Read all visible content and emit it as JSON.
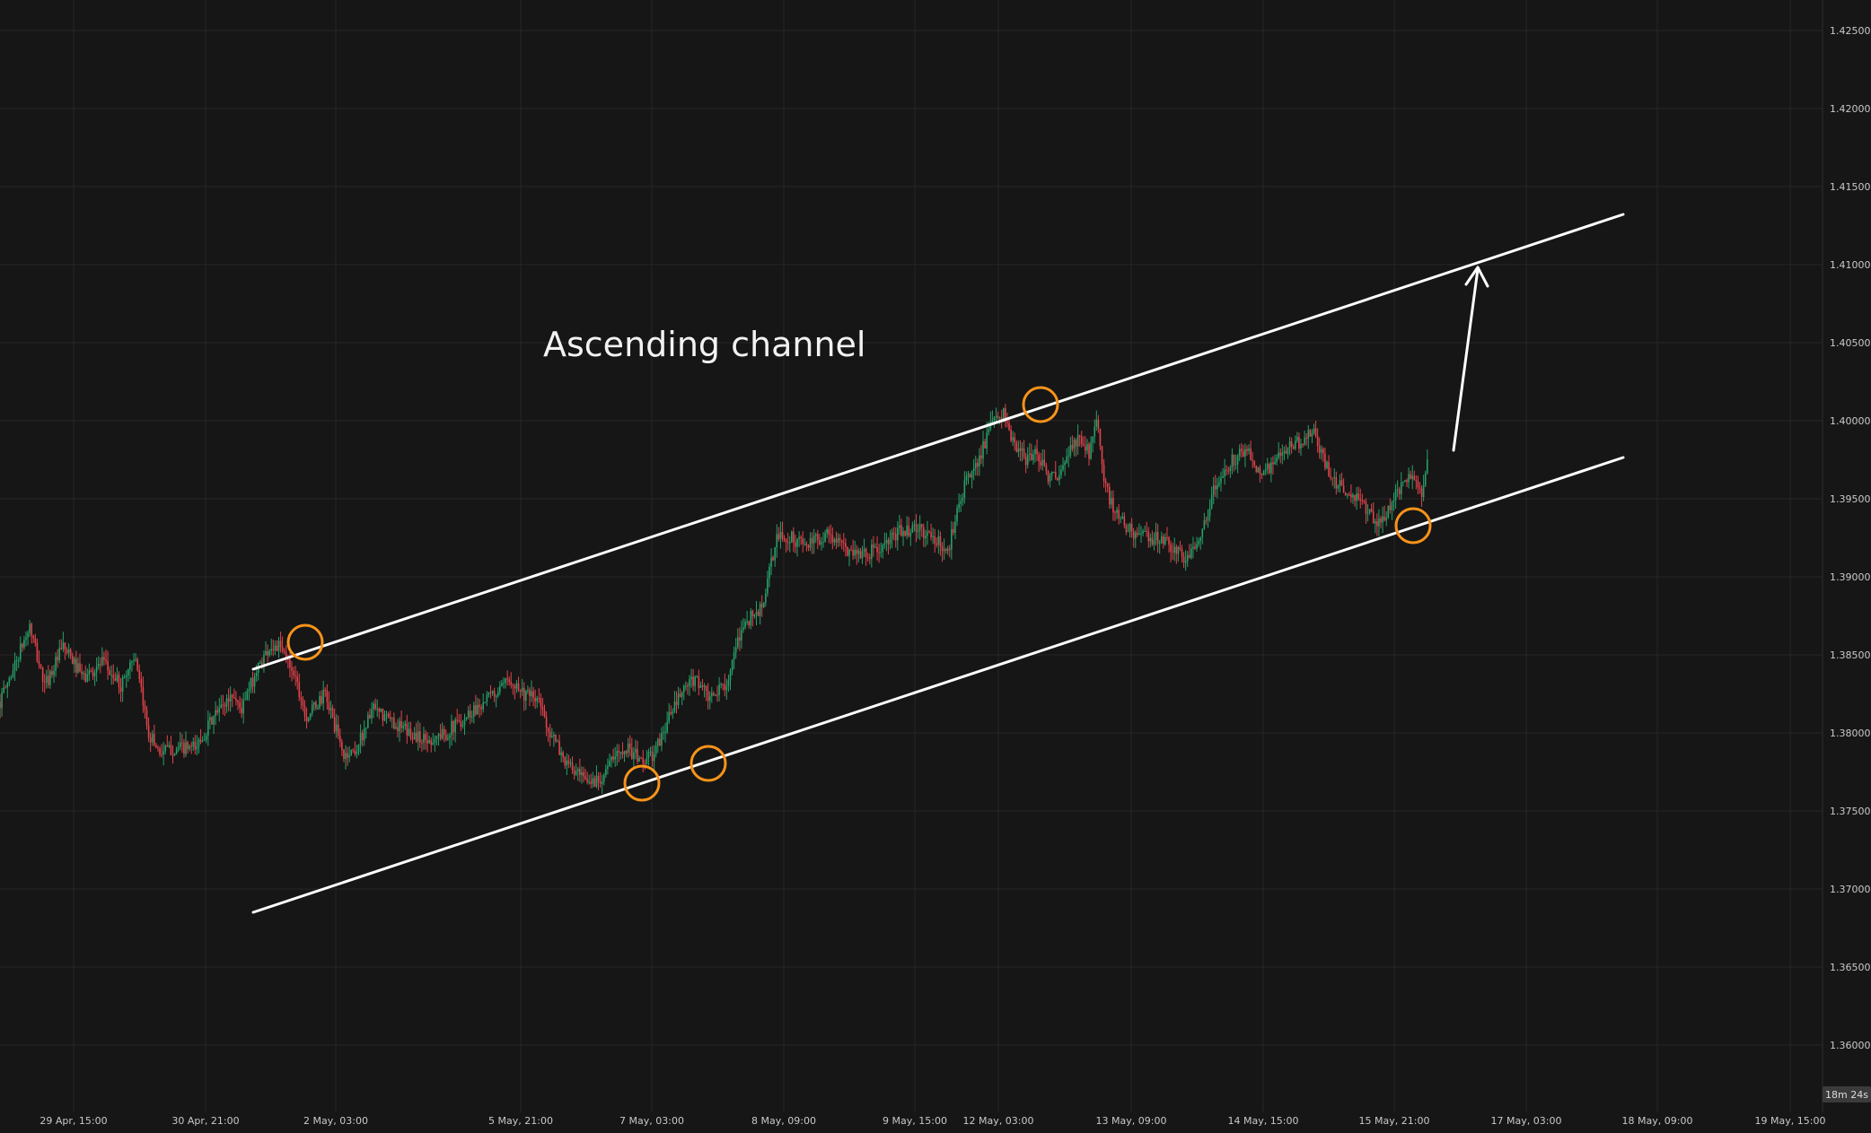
{
  "chart_data": {
    "type": "candlestick",
    "annotation": "Ascending channel",
    "ylim": [
      1.355,
      1.427
    ],
    "y_ticks": [
      "1.42500",
      "1.42000",
      "1.41500",
      "1.41000",
      "1.40500",
      "1.40000",
      "1.39500",
      "1.39000",
      "1.38500",
      "1.38000",
      "1.37500",
      "1.37000",
      "1.36500",
      "1.36000"
    ],
    "x_ticks": [
      "29 Apr, 15:00",
      "30 Apr, 21:00",
      "2 May, 03:00",
      "5 May, 21:00",
      "7 May, 03:00",
      "8 May, 09:00",
      "9 May, 15:00",
      "12 May, 03:00",
      "13 May, 09:00",
      "14 May, 15:00",
      "15 May, 21:00",
      "17 May, 03:00",
      "18 May, 09:00",
      "19 May, 15:00"
    ],
    "countdown": "18m 24s",
    "colors": {
      "background": "#161616",
      "grid": "#262626",
      "up": "#26a069",
      "down": "#e2434b",
      "channel": "#ffffff",
      "marker": "#f7931a",
      "arrow": "#ffffff"
    },
    "price_path": [
      [
        0,
        1.382
      ],
      [
        10,
        1.385
      ],
      [
        16,
        1.3868
      ],
      [
        24,
        1.383
      ],
      [
        34,
        1.3855
      ],
      [
        45,
        1.3835
      ],
      [
        55,
        1.3845
      ],
      [
        65,
        1.383
      ],
      [
        72,
        1.385
      ],
      [
        80,
        1.38
      ],
      [
        86,
        1.3788
      ],
      [
        95,
        1.379
      ],
      [
        105,
        1.379
      ],
      [
        115,
        1.381
      ],
      [
        125,
        1.3825
      ],
      [
        130,
        1.3815
      ],
      [
        138,
        1.384
      ],
      [
        145,
        1.3855
      ],
      [
        150,
        1.3855
      ],
      [
        158,
        1.384
      ],
      [
        165,
        1.381
      ],
      [
        175,
        1.3825
      ],
      [
        185,
        1.3785
      ],
      [
        192,
        1.379
      ],
      [
        200,
        1.3815
      ],
      [
        210,
        1.3808
      ],
      [
        220,
        1.38
      ],
      [
        230,
        1.3795
      ],
      [
        240,
        1.38
      ],
      [
        250,
        1.381
      ],
      [
        260,
        1.382
      ],
      [
        270,
        1.3828
      ],
      [
        275,
        1.3835
      ],
      [
        282,
        1.3825
      ],
      [
        290,
        1.382
      ],
      [
        296,
        1.38
      ],
      [
        305,
        1.378
      ],
      [
        315,
        1.3768
      ],
      [
        322,
        1.377
      ],
      [
        328,
        1.378
      ],
      [
        336,
        1.3792
      ],
      [
        345,
        1.3782
      ],
      [
        352,
        1.3786
      ],
      [
        360,
        1.381
      ],
      [
        368,
        1.3828
      ],
      [
        375,
        1.3835
      ],
      [
        382,
        1.382
      ],
      [
        392,
        1.3835
      ],
      [
        400,
        1.387
      ],
      [
        410,
        1.388
      ],
      [
        418,
        1.3925
      ],
      [
        425,
        1.3925
      ],
      [
        435,
        1.392
      ],
      [
        445,
        1.3928
      ],
      [
        455,
        1.3918
      ],
      [
        465,
        1.3915
      ],
      [
        475,
        1.3918
      ],
      [
        485,
        1.393
      ],
      [
        495,
        1.393
      ],
      [
        505,
        1.3922
      ],
      [
        510,
        1.3915
      ],
      [
        516,
        1.395
      ],
      [
        522,
        1.3965
      ],
      [
        528,
        1.398
      ],
      [
        534,
        1.3998
      ],
      [
        540,
        1.4005
      ],
      [
        545,
        1.3985
      ],
      [
        552,
        1.3975
      ],
      [
        558,
        1.398
      ],
      [
        564,
        1.3965
      ],
      [
        570,
        1.3962
      ],
      [
        575,
        1.398
      ],
      [
        580,
        1.3988
      ],
      [
        586,
        1.398
      ],
      [
        590,
        1.4005
      ],
      [
        594,
        1.396
      ],
      [
        600,
        1.394
      ],
      [
        608,
        1.393
      ],
      [
        616,
        1.3925
      ],
      [
        624,
        1.3925
      ],
      [
        632,
        1.3918
      ],
      [
        638,
        1.391
      ],
      [
        642,
        1.3918
      ],
      [
        648,
        1.3935
      ],
      [
        654,
        1.3958
      ],
      [
        660,
        1.397
      ],
      [
        666,
        1.3978
      ],
      [
        672,
        1.3978
      ],
      [
        678,
        1.3968
      ],
      [
        684,
        1.397
      ],
      [
        690,
        1.3978
      ],
      [
        696,
        1.3985
      ],
      [
        702,
        1.3988
      ],
      [
        706,
        1.3994
      ],
      [
        712,
        1.3975
      ],
      [
        718,
        1.3962
      ],
      [
        724,
        1.3955
      ],
      [
        730,
        1.395
      ],
      [
        736,
        1.3942
      ],
      [
        742,
        1.3935
      ],
      [
        748,
        1.3945
      ],
      [
        754,
        1.3958
      ],
      [
        760,
        1.3965
      ],
      [
        765,
        1.3955
      ],
      [
        768,
        1.3975
      ]
    ]
  }
}
